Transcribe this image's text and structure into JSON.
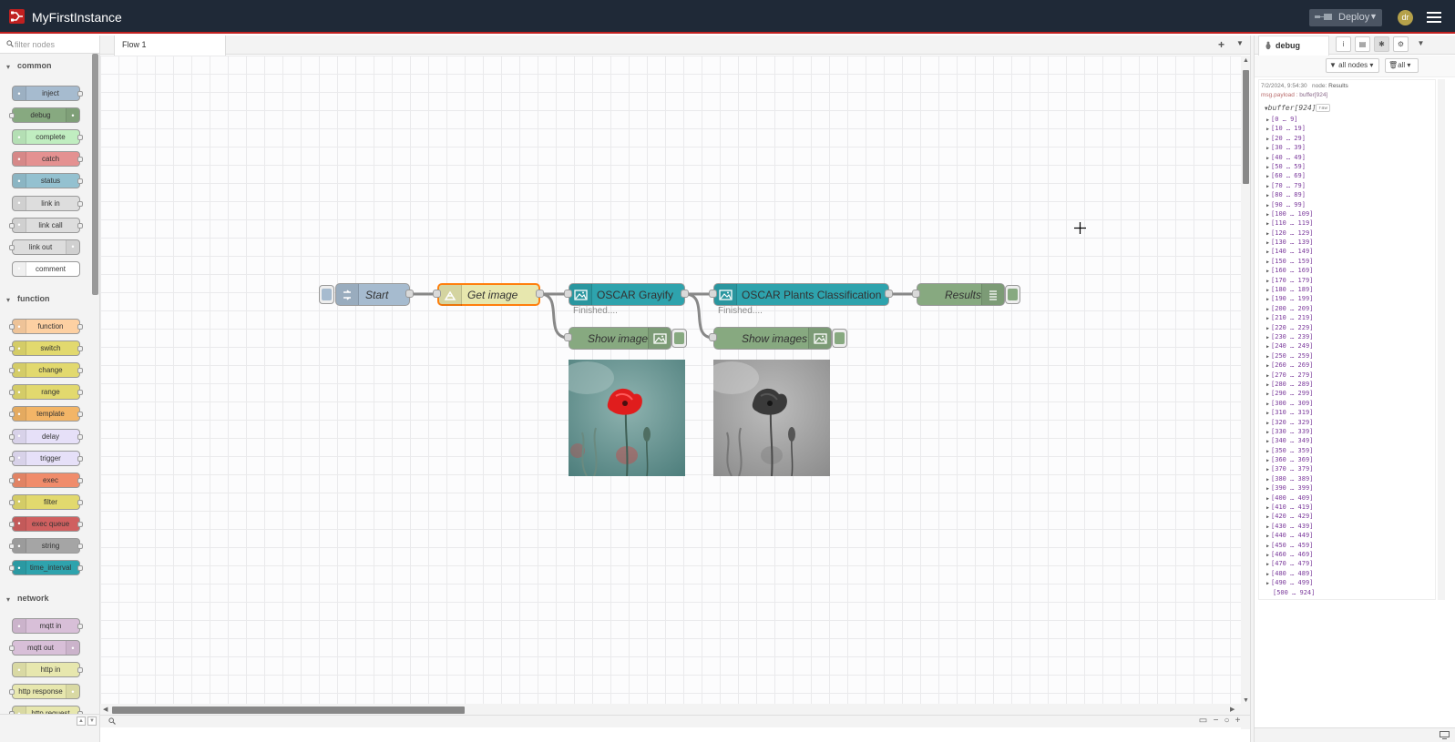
{
  "app": {
    "title": "MyFirstInstance",
    "deploy_label": "Deploy",
    "user_initials": "dr"
  },
  "palette": {
    "search_placeholder": "filter nodes",
    "categories": [
      {
        "label": "common",
        "nodes": [
          {
            "label": "inject",
            "color": "#a6bbcf",
            "icon": "arrow-icon",
            "icon_side": "left"
          },
          {
            "label": "debug",
            "color": "#87a980",
            "icon": "list-icon",
            "icon_side": "right"
          },
          {
            "label": "complete",
            "color": "#c0edc0",
            "icon": "exclamation-icon",
            "icon_side": "left"
          },
          {
            "label": "catch",
            "color": "#e49191",
            "icon": "exclamation-icon",
            "icon_side": "left"
          },
          {
            "label": "status",
            "color": "#94c1d0",
            "icon": "pulse-icon",
            "icon_side": "left"
          },
          {
            "label": "link in",
            "color": "#dddddd",
            "icon": "link-icon",
            "icon_side": "left"
          },
          {
            "label": "link call",
            "color": "#dddddd",
            "icon": "link-icon",
            "icon_side": "left"
          },
          {
            "label": "link out",
            "color": "#dddddd",
            "icon": "link-icon",
            "icon_side": "right"
          },
          {
            "label": "comment",
            "color": "#ffffff",
            "icon": "comment-icon",
            "icon_side": "left"
          }
        ]
      },
      {
        "label": "function",
        "nodes": [
          {
            "label": "function",
            "color": "#fdd0a2",
            "icon": "function-icon",
            "icon_side": "left"
          },
          {
            "label": "switch",
            "color": "#e2d96e",
            "icon": "switch-icon",
            "icon_side": "left"
          },
          {
            "label": "change",
            "color": "#e2d96e",
            "icon": "shuffle-icon",
            "icon_side": "left"
          },
          {
            "label": "range",
            "color": "#e2d96e",
            "icon": "range-icon",
            "icon_side": "left"
          },
          {
            "label": "template",
            "color": "#f3b567",
            "icon": "brace-icon",
            "icon_side": "left"
          },
          {
            "label": "delay",
            "color": "#e6e0f8",
            "icon": "clock-icon",
            "icon_side": "left"
          },
          {
            "label": "trigger",
            "color": "#e6e0f8",
            "icon": "trigger-icon",
            "icon_side": "left"
          },
          {
            "label": "exec",
            "color": "#f08c6b",
            "icon": "gear-icon",
            "icon_side": "left"
          },
          {
            "label": "filter",
            "color": "#e2d96e",
            "icon": "filter-icon",
            "icon_side": "left"
          },
          {
            "label": "exec queue",
            "color": "#d06060",
            "icon": "gear-icon",
            "icon_side": "left"
          },
          {
            "label": "string",
            "color": "#a5a5a5",
            "icon": "string-icon",
            "icon_side": "left"
          },
          {
            "label": "time_interval",
            "color": "#2ea3ad",
            "icon": "arrow-icon",
            "icon_side": "left"
          }
        ]
      },
      {
        "label": "network",
        "nodes": [
          {
            "label": "mqtt in",
            "color": "#d8bfd8",
            "icon": "wifi-icon",
            "icon_side": "left"
          },
          {
            "label": "mqtt out",
            "color": "#d8bfd8",
            "icon": "wifi-icon",
            "icon_side": "right"
          },
          {
            "label": "http in",
            "color": "#e7e7ae",
            "icon": "globe-icon",
            "icon_side": "left"
          },
          {
            "label": "http response",
            "color": "#e7e7ae",
            "icon": "globe-icon",
            "icon_side": "right"
          },
          {
            "label": "http request",
            "color": "#e7e7ae",
            "icon": "globe-icon",
            "icon_side": "left"
          }
        ]
      }
    ]
  },
  "workspace": {
    "tab_label": "Flow 1",
    "nodes": {
      "start": {
        "label": "Start",
        "color": "#a6bbcf"
      },
      "get_image": {
        "label": "Get image",
        "color": "#e7e7ae",
        "border": "#ff7f0e"
      },
      "grayify": {
        "label": "OSCAR Grayify",
        "color": "#2ea3ad",
        "status": "Finished...."
      },
      "plants": {
        "label": "OSCAR Plants Classification",
        "color": "#2ea3ad",
        "status": "Finished...."
      },
      "results": {
        "label": "Results",
        "color": "#87a980"
      },
      "show_image": {
        "label": "Show image",
        "color": "#87a980"
      },
      "show_images": {
        "label": "Show images",
        "color": "#87a980"
      }
    }
  },
  "sidebar": {
    "tab_label": "debug",
    "filter_nodes": "all nodes",
    "filter_clear": "all",
    "message": {
      "timestamp": "7/2/2024, 9:54:30",
      "node_prefix": "node:",
      "node_name": "Results",
      "topic": "msg.payload :",
      "type": "buffer[924]",
      "root_label": "buffer[924]",
      "raw_label": "raw",
      "ranges": [
        "[0 … 9]",
        "[10 … 19]",
        "[20 … 29]",
        "[30 … 39]",
        "[40 … 49]",
        "[50 … 59]",
        "[60 … 69]",
        "[70 … 79]",
        "[80 … 89]",
        "[90 … 99]",
        "[100 … 109]",
        "[110 … 119]",
        "[120 … 129]",
        "[130 … 139]",
        "[140 … 149]",
        "[150 … 159]",
        "[160 … 169]",
        "[170 … 179]",
        "[180 … 189]",
        "[190 … 199]",
        "[200 … 209]",
        "[210 … 219]",
        "[220 … 229]",
        "[230 … 239]",
        "[240 … 249]",
        "[250 … 259]",
        "[260 … 269]",
        "[270 … 279]",
        "[280 … 289]",
        "[290 … 299]",
        "[300 … 309]",
        "[310 … 319]",
        "[320 … 329]",
        "[330 … 339]",
        "[340 … 349]",
        "[350 … 359]",
        "[360 … 369]",
        "[370 … 379]",
        "[380 … 389]",
        "[390 … 399]",
        "[400 … 409]",
        "[410 … 419]",
        "[420 … 429]",
        "[430 … 439]",
        "[440 … 449]",
        "[450 … 459]",
        "[460 … 469]",
        "[470 … 479]",
        "[480 … 489]",
        "[490 … 499]",
        "[500 … 924]"
      ]
    }
  }
}
